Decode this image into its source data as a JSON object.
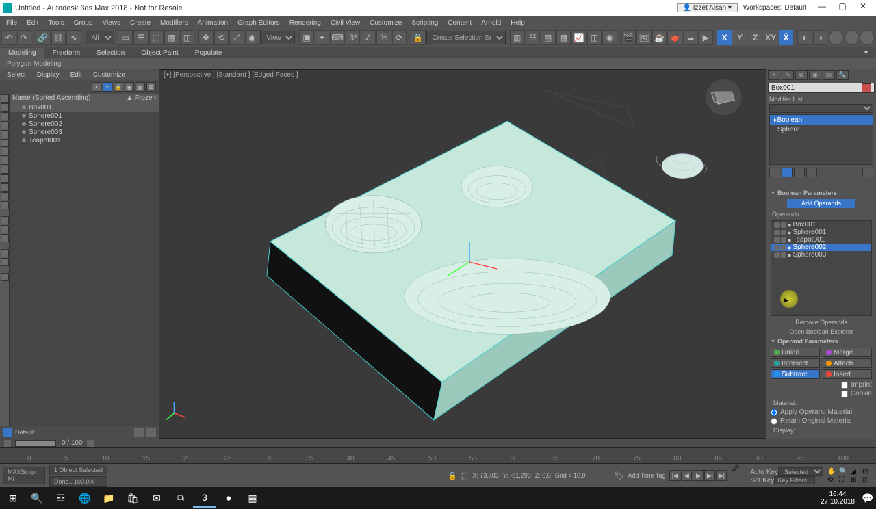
{
  "title": "Untitled - Autodesk 3ds Max 2018 - Not for Resale",
  "user": "Izzet Alsan",
  "workspace_label": "Workspaces:",
  "workspace_value": "Default",
  "menus": [
    "File",
    "Edit",
    "Tools",
    "Group",
    "Views",
    "Create",
    "Modifiers",
    "Animation",
    "Graph Editors",
    "Rendering",
    "Civil View",
    "Customize",
    "Scripting",
    "Content",
    "Arnold",
    "Help"
  ],
  "tabs": [
    "Modeling",
    "Freeform",
    "Selection",
    "Object Paint",
    "Populate"
  ],
  "ribbon": "Polygon Modeling",
  "toolbar_all": "All",
  "toolbar_view": "View",
  "toolbar_selset": "Create Selection Se",
  "scene_menu": [
    "Select",
    "Display",
    "Edit",
    "Customize"
  ],
  "scene_header": {
    "col1": "Name (Sorted Ascending)",
    "col2": "▲  Frozen"
  },
  "scene_items": [
    {
      "name": "Box001",
      "sel": true
    },
    {
      "name": "Sphere001",
      "sel": false
    },
    {
      "name": "Sphere002",
      "sel": false
    },
    {
      "name": "Sphere003",
      "sel": false
    },
    {
      "name": "Teapot001",
      "sel": false
    }
  ],
  "viewport_label": "[+] [Perspective ] [Standard ] [Edged Faces ]",
  "cmd_object": "Box001",
  "cmd_modlist": "Modifier List",
  "cmd_stack": [
    {
      "name": "Boolean",
      "sel": true
    },
    {
      "name": "Sphere",
      "sel": false
    }
  ],
  "bool_section": "Boolean Parameters",
  "bool_addop": "Add Operands",
  "bool_operands_label": "Operands:",
  "bool_operands": [
    {
      "name": "Box001",
      "sel": false
    },
    {
      "name": "Sphere001",
      "sel": false
    },
    {
      "name": "Teapot001",
      "sel": false
    },
    {
      "name": "Sphere002",
      "sel": true
    },
    {
      "name": "Sphere003",
      "sel": false
    }
  ],
  "bool_remove": "Remove Operands",
  "bool_explorer": "Open Boolean Explorer",
  "opparam_section": "Operand Parameters",
  "opbtns": {
    "union": "Union",
    "merge": "Merge",
    "intersect": "Intersect",
    "attach": "Attach",
    "subtract": "Subtract",
    "insert": "Insert",
    "imprint": "Imprint",
    "cookie": "Cookie"
  },
  "material_label": "Material:",
  "mat_apply": "Apply Operand Material",
  "mat_retain": "Retain Original Material",
  "display_label": "Display:",
  "bottombar": {
    "default": "Default"
  },
  "frame": "0 / 100",
  "timeline_marks": [
    "0",
    "5",
    "10",
    "15",
    "20",
    "25",
    "30",
    "35",
    "40",
    "45",
    "50",
    "55",
    "60",
    "65",
    "70",
    "75",
    "80",
    "85",
    "90",
    "95",
    "100"
  ],
  "status": {
    "sel": "1 Object Selected",
    "done": "Done...100.0%",
    "script": "MAXScript Mi",
    "x": "X: 73,783",
    "y": "Y: -81,293",
    "z": "Z: 0,0",
    "grid": "Grid = 10,0",
    "addtag": "Add Time Tag",
    "autokey": "Auto Key",
    "setkey": "Set Key",
    "selected": "Selected",
    "keyfilters": "Key Filters..."
  },
  "clock": {
    "time": "16:44",
    "date": "27.10.2018"
  }
}
